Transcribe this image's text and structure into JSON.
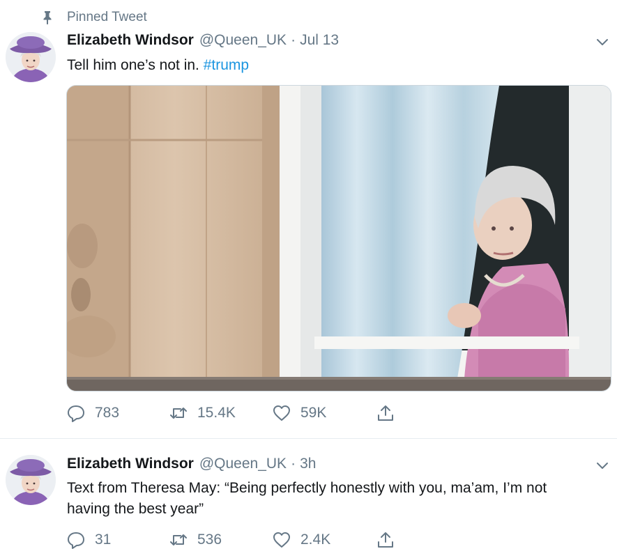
{
  "pinned_label": "Pinned Tweet",
  "tweets": [
    {
      "name": "Elizabeth Windsor",
      "handle": "@Queen_UK",
      "separator": "·",
      "time": "Jul 13",
      "text": "Tell him one’s not in.",
      "hashtag": "#trump",
      "has_media": true,
      "replies": "783",
      "retweets": "15.4K",
      "likes": "59K"
    },
    {
      "name": "Elizabeth Windsor",
      "handle": "@Queen_UK",
      "separator": "·",
      "time": "3h",
      "text_line1": "Text from Theresa May: “Being perfectly honestly with you, ma’am, I’m not",
      "text_line2": "having the best year”",
      "has_media": false,
      "replies": "31",
      "retweets": "536",
      "likes": "2.4K"
    }
  ],
  "colors": {
    "text_primary": "#14171a",
    "text_secondary": "#657786",
    "link": "#1b95e0",
    "divider": "#e6ecf0",
    "hat_purple": "#7d5ba6"
  },
  "icons": {
    "pin": "pin-icon",
    "caret": "chevron-down-icon",
    "reply": "reply-icon",
    "retweet": "retweet-icon",
    "like": "heart-icon",
    "share": "share-icon"
  }
}
